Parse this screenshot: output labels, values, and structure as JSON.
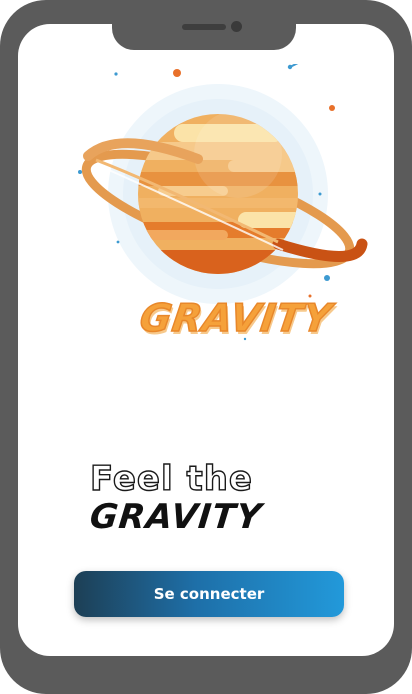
{
  "app": {
    "logo_text": "GRAVITY"
  },
  "hero": {
    "tagline_line1": "Feel the",
    "tagline_line2": "GRAVITY"
  },
  "actions": {
    "login_label": "Se connecter"
  },
  "colors": {
    "phone_frame": "#5b5b5b",
    "planet_primary": "#f0a04b",
    "planet_light": "#f8d28f",
    "planet_dark": "#e0691f",
    "button_start": "#1d3f55",
    "button_end": "#2299da",
    "logo": "#f5a13a"
  },
  "icons": {
    "illustration": "planet-saturn-icon",
    "shooting_star": "shooting-star-icon"
  }
}
